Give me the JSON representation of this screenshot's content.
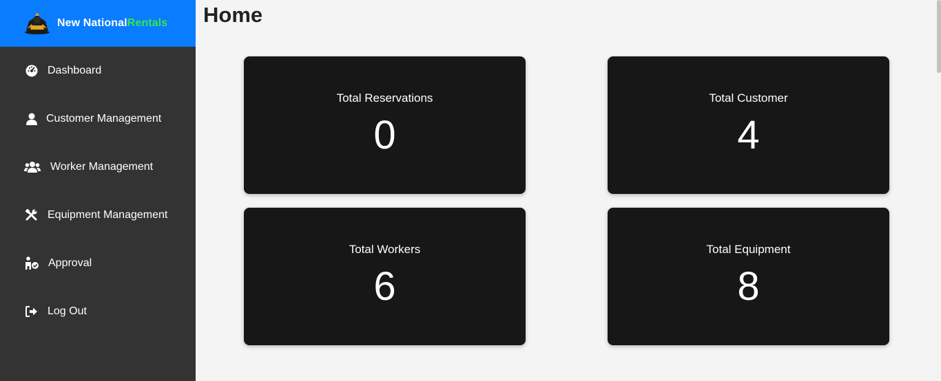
{
  "brand": {
    "name_part1": "New National",
    "name_part2": "Rentals"
  },
  "sidebar": {
    "items": [
      {
        "label": "Dashboard",
        "icon": "dashboard-icon"
      },
      {
        "label": "Customer Management",
        "icon": "user-icon"
      },
      {
        "label": "Worker Management",
        "icon": "users-icon"
      },
      {
        "label": "Equipment Management",
        "icon": "tools-icon"
      },
      {
        "label": "Approval",
        "icon": "user-check-icon"
      },
      {
        "label": "Log Out",
        "icon": "logout-icon"
      }
    ]
  },
  "main": {
    "title": "Home",
    "cards": [
      {
        "label": "Total Reservations",
        "value": "0"
      },
      {
        "label": "Total Customer",
        "value": "4"
      },
      {
        "label": "Total Workers",
        "value": "6"
      },
      {
        "label": "Total Equipment",
        "value": "8"
      }
    ]
  },
  "colors": {
    "brand_bar": "#0a7cff",
    "brand_accent": "#33e64d",
    "sidebar": "#333333",
    "card": "#171717",
    "background": "#f4f4f4"
  }
}
